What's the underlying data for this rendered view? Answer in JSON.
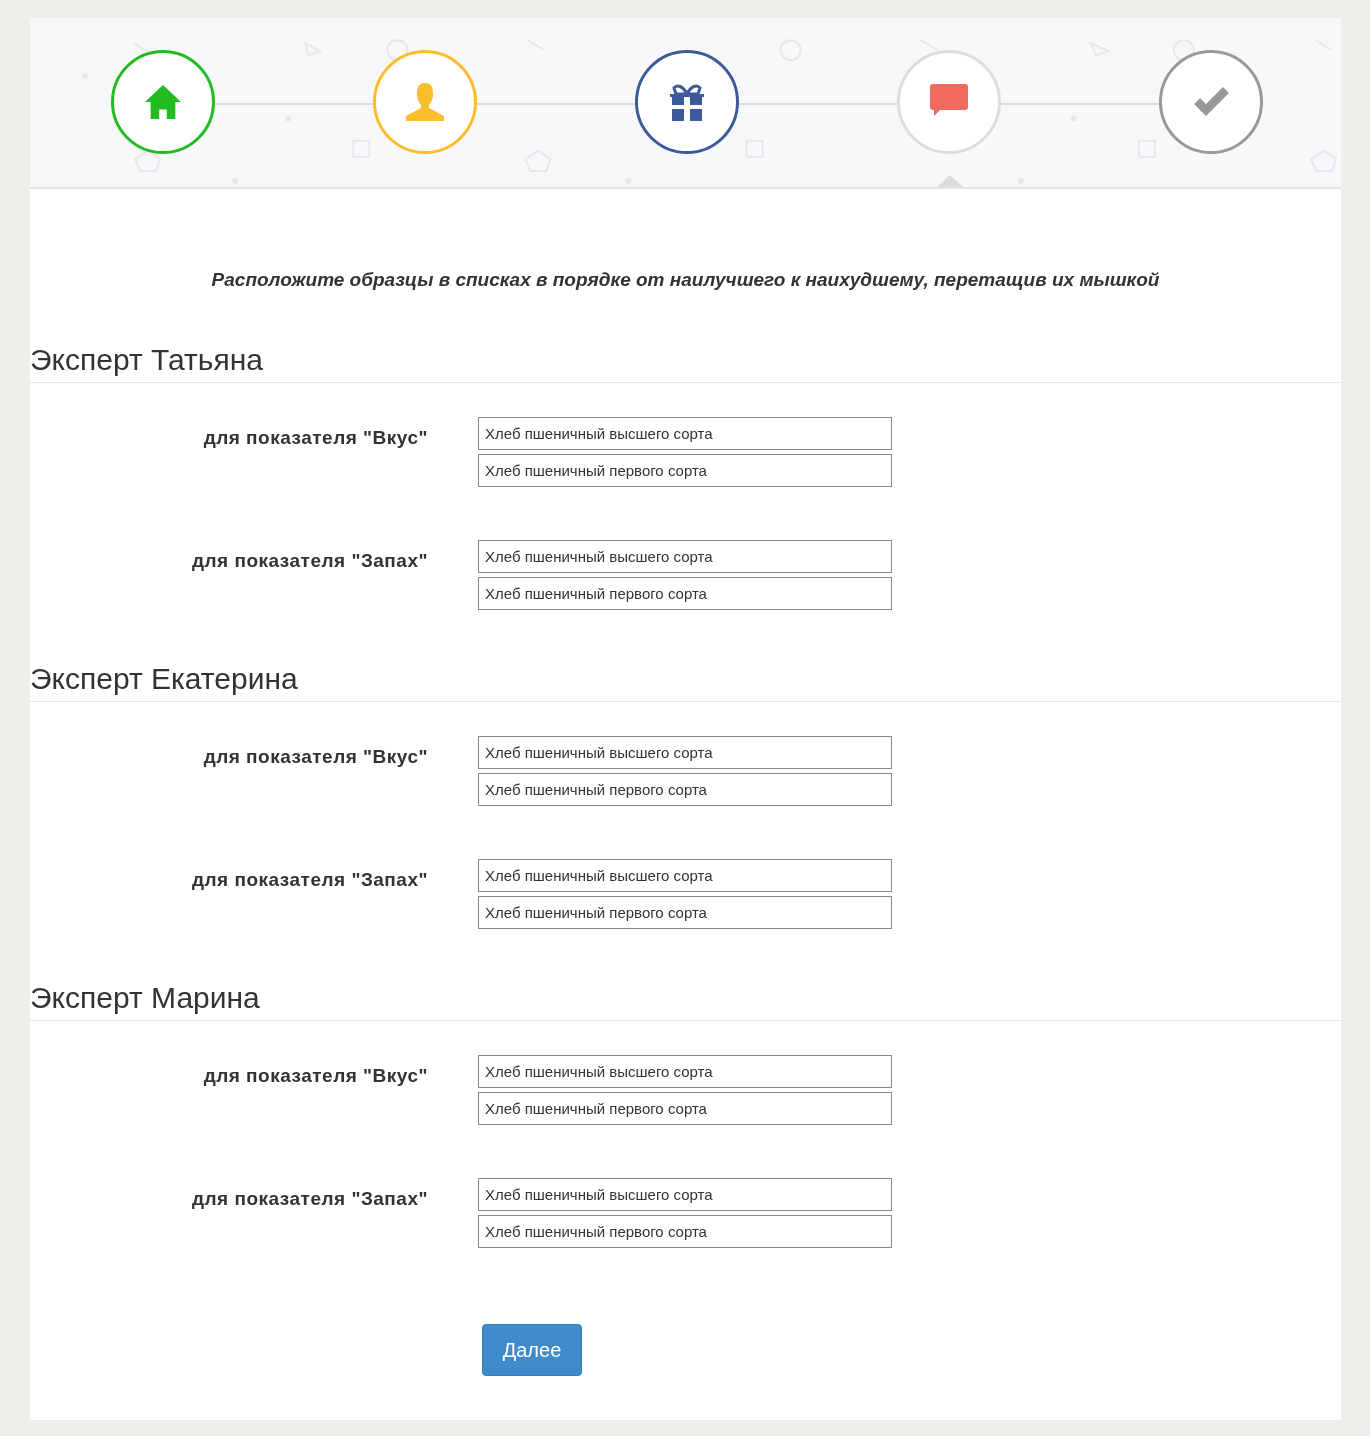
{
  "steps": [
    {
      "kind": "home",
      "color": "#22bb22",
      "selected": false
    },
    {
      "kind": "user",
      "color": "#fbbd2b",
      "selected": false
    },
    {
      "kind": "gift",
      "color": "#3c5a99",
      "selected": false
    },
    {
      "kind": "comment",
      "color": "#dddddd",
      "selected": true
    },
    {
      "kind": "check",
      "color": "#999999",
      "selected": false
    }
  ],
  "instruction": "Расположите образцы в списках в порядке от наилучшего к наихудшему, перетащив их мышкой",
  "experts": [
    {
      "title": "Эксперт Татьяна",
      "criteria": [
        {
          "label": "для показателя \"Вкус\"",
          "items": [
            "Хлеб пшеничный высшего сорта",
            "Хлеб пшеничный первого сорта"
          ]
        },
        {
          "label": "для показателя \"Запах\"",
          "items": [
            "Хлеб пшеничный высшего сорта",
            "Хлеб пшеничный первого сорта"
          ]
        }
      ]
    },
    {
      "title": "Эксперт Екатерина",
      "criteria": [
        {
          "label": "для показателя \"Вкус\"",
          "items": [
            "Хлеб пшеничный высшего сорта",
            "Хлеб пшеничный первого сорта"
          ]
        },
        {
          "label": "для показателя \"Запах\"",
          "items": [
            "Хлеб пшеничный высшего сорта",
            "Хлеб пшеничный первого сорта"
          ]
        }
      ]
    },
    {
      "title": "Эксперт Марина",
      "criteria": [
        {
          "label": "для показателя \"Вкус\"",
          "items": [
            "Хлеб пшеничный высшего сорта",
            "Хлеб пшеничный первого сорта"
          ]
        },
        {
          "label": "для показателя \"Запах\"",
          "items": [
            "Хлеб пшеничный высшего сорта",
            "Хлеб пшеничный первого сорта"
          ]
        }
      ]
    }
  ],
  "next_button": "Далее"
}
